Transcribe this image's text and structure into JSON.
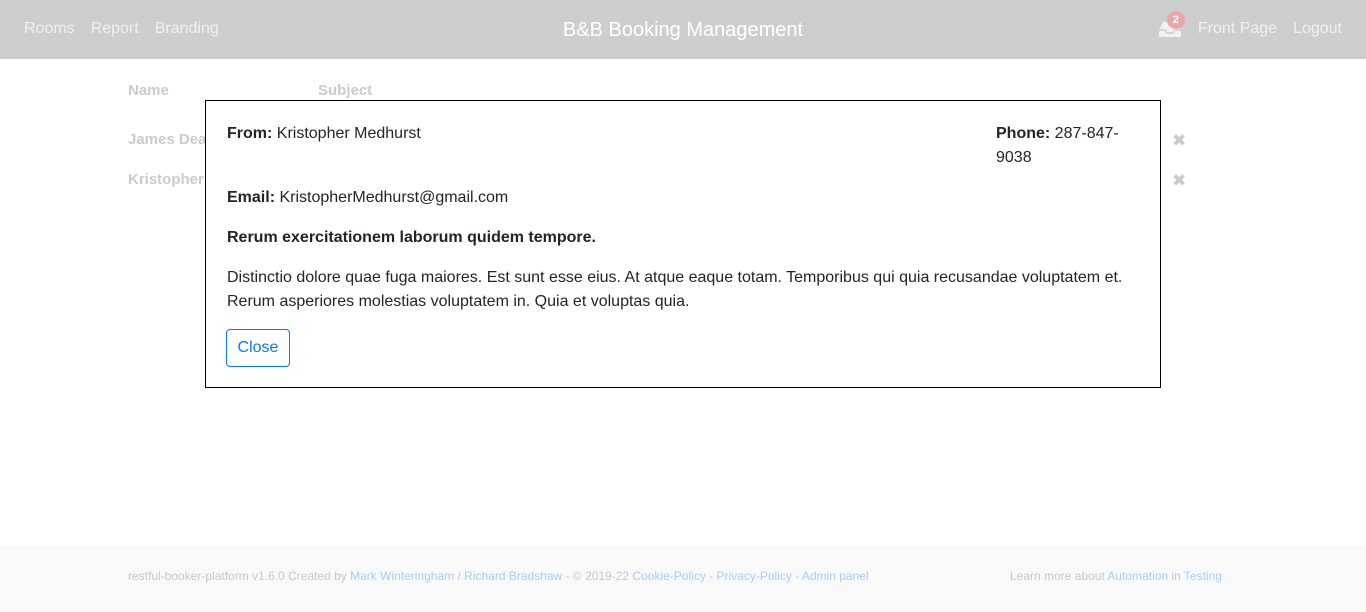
{
  "navbar": {
    "links": [
      "Rooms",
      "Report",
      "Branding"
    ],
    "brand": "B&B Booking Management",
    "notification_count": "2",
    "front_page": "Front Page",
    "logout": "Logout"
  },
  "table": {
    "headers": [
      "Name",
      "Subject"
    ],
    "rows": [
      {
        "name": "James Dea"
      },
      {
        "name": "Kristopher"
      }
    ],
    "delete_glyph": "✖"
  },
  "modal": {
    "from_label": "From:",
    "from_value": "Kristopher Medhurst",
    "phone_label": "Phone:",
    "phone_value": "287-847-9038",
    "email_label": "Email:",
    "email_value": "KristopherMedhurst@gmail.com",
    "subject": "Rerum exercitationem laborum quidem tempore.",
    "body": "Distinctio dolore quae fuga maiores. Est sunt esse eius. At atque eaque totam. Temporibus qui quia recusandae voluptatem et. Rerum asperiores molestias voluptatem in. Quia et voluptas quia.",
    "close_label": "Close"
  },
  "footer": {
    "prefix": "restful-booker-platform v1.6.0 Created by",
    "author1": "Mark Winteringham",
    "sep1": "/",
    "author2": "Richard Bradshaw",
    "copyright": "- © 2019-22",
    "cookie_policy": "Cookie-Policy",
    "dash1": "-",
    "privacy_policy": "Privacy-Policy",
    "dash2": "-",
    "admin_panel": "Admin panel",
    "learn_more": "Learn more about",
    "automation": "Automation in Testing"
  },
  "colors": {
    "accent": "#007bff",
    "navbar_bg": "#cdced0",
    "badge": "#e9a7a7"
  },
  "icons": {
    "inbox": "inbox-icon",
    "delete": "delete-icon"
  }
}
